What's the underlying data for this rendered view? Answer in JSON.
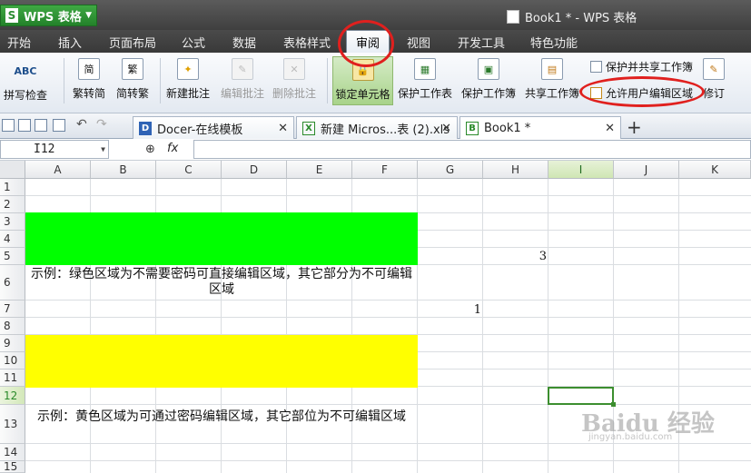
{
  "app": {
    "menu_button_label": "WPS 表格",
    "logo_glyph": "S",
    "window_title": "Book1 * - WPS 表格"
  },
  "ribbon_tabs": [
    {
      "label": "开始"
    },
    {
      "label": "插入"
    },
    {
      "label": "页面布局"
    },
    {
      "label": "公式"
    },
    {
      "label": "数据"
    },
    {
      "label": "表格样式"
    },
    {
      "label": "审阅",
      "active": true
    },
    {
      "label": "视图"
    },
    {
      "label": "开发工具"
    },
    {
      "label": "特色功能"
    }
  ],
  "ribbon": {
    "spell_check": "拼写检查",
    "spell_icon": "ABC",
    "to_simplified": "繁转简",
    "to_simplified_icon": "简",
    "to_traditional": "简转繁",
    "to_traditional_icon": "繁",
    "new_comment": "新建批注",
    "edit_comment": "编辑批注",
    "delete_comment": "删除批注",
    "lock_cells": "锁定单元格",
    "protect_sheet": "保护工作表",
    "protect_workbook": "保护工作簿",
    "share_workbook": "共享工作簿",
    "protect_share_workbook": "保护并共享工作簿",
    "allow_edit_ranges": "允许用户编辑区域",
    "track_changes": "修订"
  },
  "doc_tabs": [
    {
      "label": "Docer-在线模板",
      "icon": "D"
    },
    {
      "label": "新建 Micros...表 (2).xls",
      "icon": "X"
    },
    {
      "label": "Book1 *",
      "icon": "B"
    }
  ],
  "formula_bar": {
    "cell_ref": "I12",
    "fx_label": "fx",
    "value": ""
  },
  "columns": [
    "A",
    "B",
    "C",
    "D",
    "E",
    "F",
    "G",
    "H",
    "I",
    "J",
    "K"
  ],
  "rows": [
    "1",
    "2",
    "3",
    "4",
    "5",
    "6",
    "7",
    "8",
    "9",
    "10",
    "11",
    "12",
    "13",
    "14",
    "15"
  ],
  "selected_cell": {
    "column": "I",
    "row": "12"
  },
  "colors": {
    "green_region": "#00ff00",
    "yellow_region": "#ffff00",
    "selection": "#3c8e2f",
    "annotation_circle": "#e0201e"
  },
  "cells": {
    "note_green": "示例：绿色区域为不需要密码可直接编辑区域，其它部分为不可编辑区域",
    "note_yellow": "示例：黄色区域为可通过密码编辑区域，其它部位为不可编辑区域",
    "h5": "3",
    "g7": "1"
  },
  "watermark": {
    "main": "Baidu 经验",
    "sub": "jingyan.baidu.com"
  }
}
